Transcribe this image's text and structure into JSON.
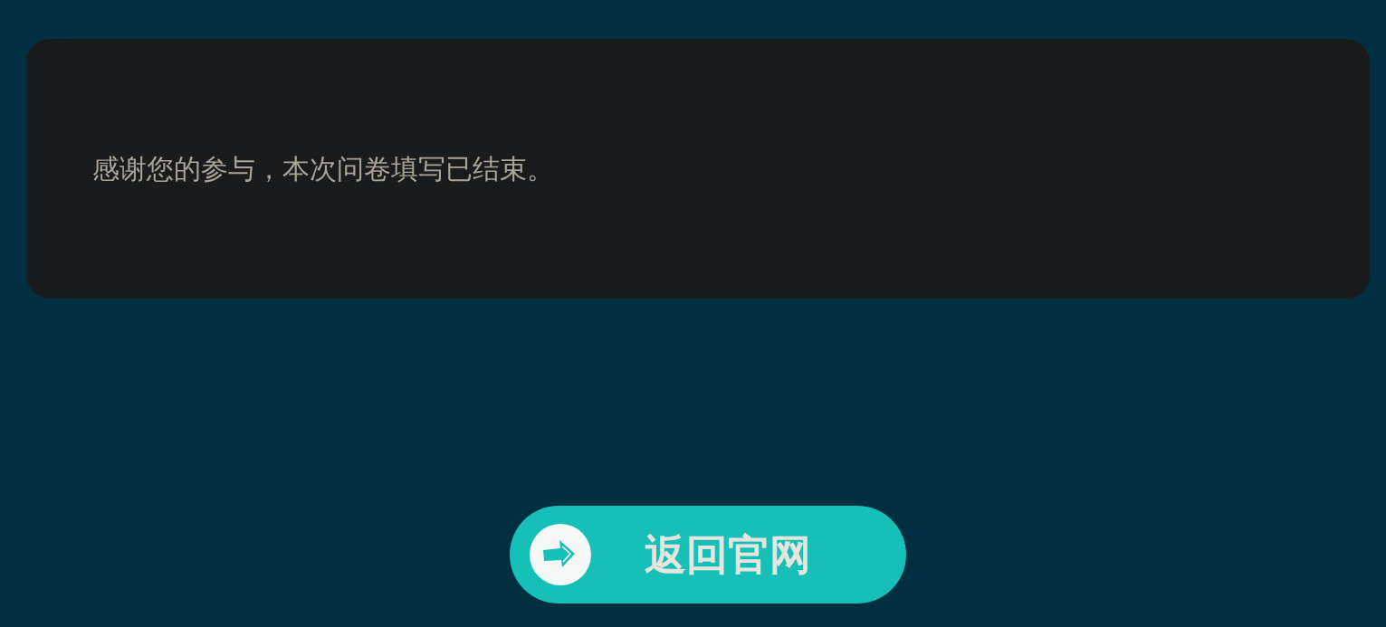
{
  "notice": {
    "message": "感谢您的参与，本次问卷填写已结束。"
  },
  "button": {
    "label": "返回官网"
  }
}
